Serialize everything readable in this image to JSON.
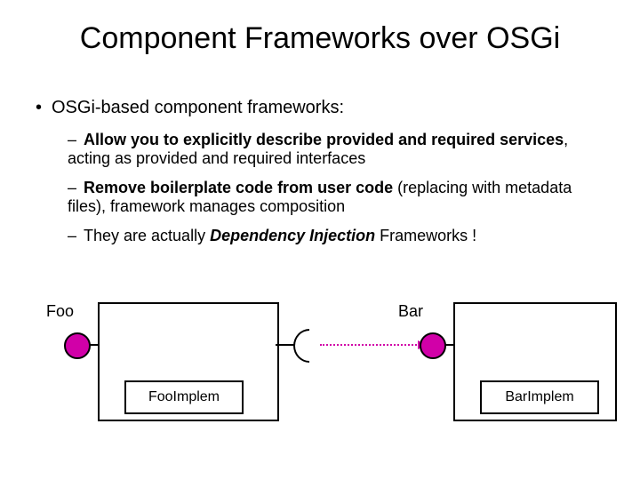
{
  "title": "Component Frameworks over OSGi",
  "bullets": [
    {
      "text": "OSGi-based component frameworks:",
      "sub": [
        {
          "bold1": "Allow you to explicitly describe provided and required services",
          "plain1": ", acting as provided and required interfaces"
        },
        {
          "bold1": "Remove boilerplate code from user code",
          "plain1": " (replacing with metadata files), framework manages composition"
        },
        {
          "plain0": "They are actually ",
          "boldit": "Dependency Injection",
          "plain1": " Frameworks !"
        }
      ]
    }
  ],
  "diagram": {
    "foo": {
      "label": "Foo",
      "impl": "FooImplem"
    },
    "bar": {
      "label": "Bar",
      "impl": "BarImplem"
    }
  }
}
